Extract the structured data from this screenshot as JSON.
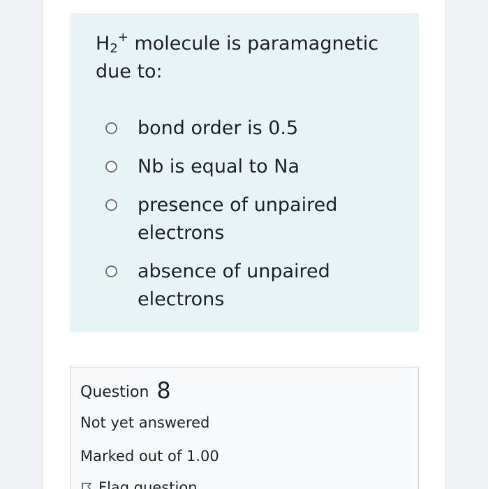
{
  "question": {
    "species_base": "H",
    "species_sub": "2",
    "species_sup": "+",
    "text_after": " molecule is paramagnetic due to:",
    "options": [
      {
        "label": "bond order is 0.5",
        "selected": false
      },
      {
        "label": "Nb is equal to Na",
        "selected": false
      },
      {
        "label": "presence of unpaired electrons",
        "selected": false
      },
      {
        "label": "absence of unpaired electrons",
        "selected": false
      }
    ]
  },
  "info": {
    "question_word": "Question",
    "question_number": "8",
    "state": "Not yet answered",
    "grade": "Marked out of 1.00",
    "flag_label": "Flag question",
    "flag_icon": "flag-outline-icon"
  }
}
